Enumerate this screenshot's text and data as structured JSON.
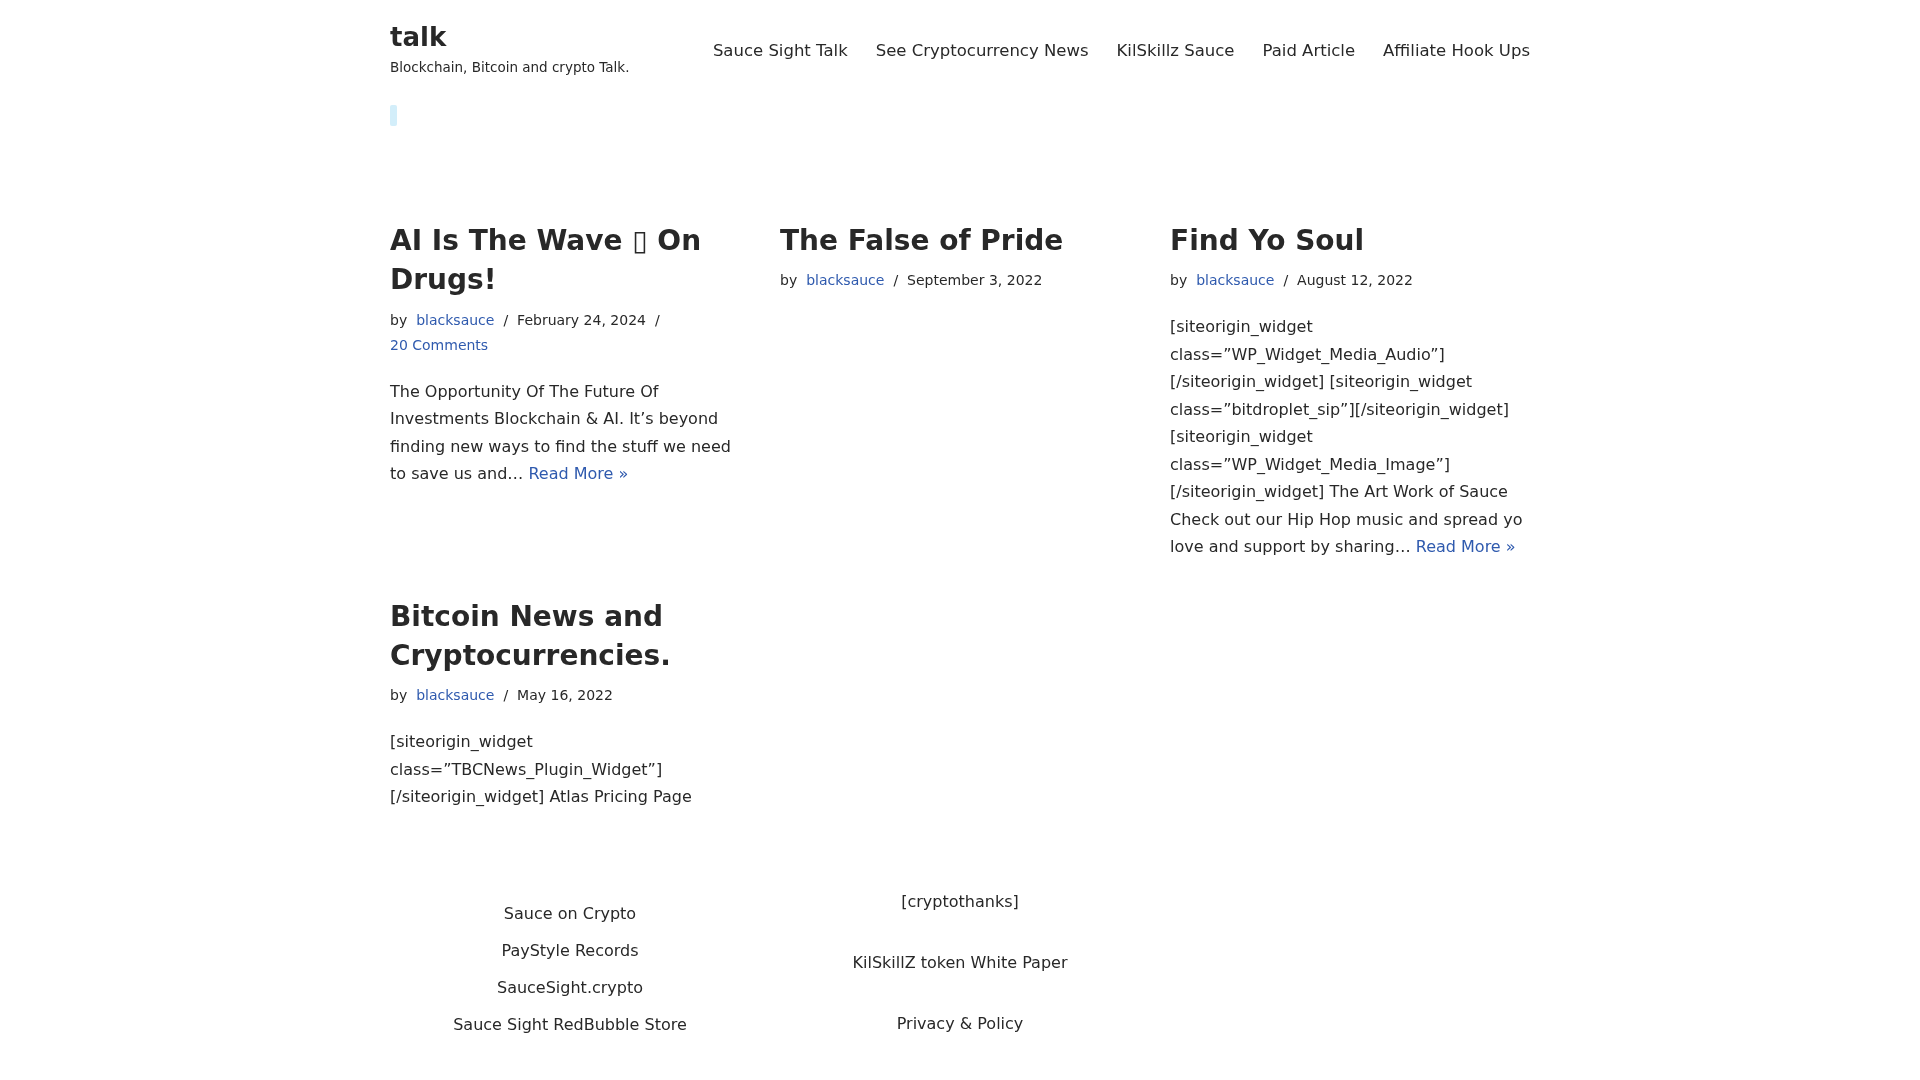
{
  "site": {
    "title": "talk",
    "tagline": "Blockchain, Bitcoin and crypto Talk."
  },
  "nav": [
    "Sauce Sight Talk",
    "See Cryptocurrency News",
    "KilSkillz Sauce",
    "Paid Article",
    "Affiliate Hook Ups"
  ],
  "posts": [
    {
      "title": "AI Is The Wave ▯ On Drugs!",
      "meta": [
        {
          "kind": "text",
          "text": "by"
        },
        {
          "kind": "link",
          "text": "blacksauce"
        },
        {
          "kind": "separator",
          "text": "/"
        },
        {
          "kind": "text",
          "text": "February 24, 2024"
        },
        {
          "kind": "separator",
          "text": "/"
        },
        {
          "kind": "link",
          "text": "20 Comments"
        }
      ],
      "excerpt": "The Opportunity Of The Future Of Investments Blockchain & AI. It’s beyond finding new ways to find the stuff we need to save us and…",
      "read_more": "Read More »"
    },
    {
      "title": "The False of Pride",
      "meta": [
        {
          "kind": "text",
          "text": "by"
        },
        {
          "kind": "link",
          "text": "blacksauce"
        },
        {
          "kind": "separator",
          "text": "/"
        },
        {
          "kind": "text",
          "text": "September 3, 2022"
        }
      ]
    },
    {
      "title": "Find Yo Soul",
      "meta": [
        {
          "kind": "text",
          "text": "by"
        },
        {
          "kind": "link",
          "text": "blacksauce"
        },
        {
          "kind": "separator",
          "text": "/"
        },
        {
          "kind": "text",
          "text": "August 12, 2022"
        }
      ],
      "excerpt": "[siteorigin_widget class=”WP_Widget_Media_Audio”][/siteorigin_widget] [siteorigin_widget class=”bitdroplet_sip”][/siteorigin_widget] [siteorigin_widget class=”WP_Widget_Media_Image”][/siteorigin_widget] The Art Work of Sauce Check out our Hip Hop music and spread yo love and support by sharing…",
      "read_more": "Read More »"
    },
    {
      "title": "Bitcoin News and Cryptocurrencies.",
      "meta": [
        {
          "kind": "text",
          "text": "by"
        },
        {
          "kind": "link",
          "text": "blacksauce"
        },
        {
          "kind": "separator",
          "text": "/"
        },
        {
          "kind": "text",
          "text": "May 16, 2022"
        }
      ],
      "excerpt": "[siteorigin_widget class=”TBCNews_Plugin_Widget”][/siteorigin_widget] Atlas Pricing Page"
    }
  ],
  "footer": {
    "column_1": [
      "Sauce on Crypto",
      "PayStyle Records",
      "SauceSight.crypto",
      "Sauce Sight RedBubble Store"
    ],
    "column_2": [
      "[cryptothanks]",
      "KilSkillZ token White Paper",
      "Privacy & Policy"
    ]
  }
}
